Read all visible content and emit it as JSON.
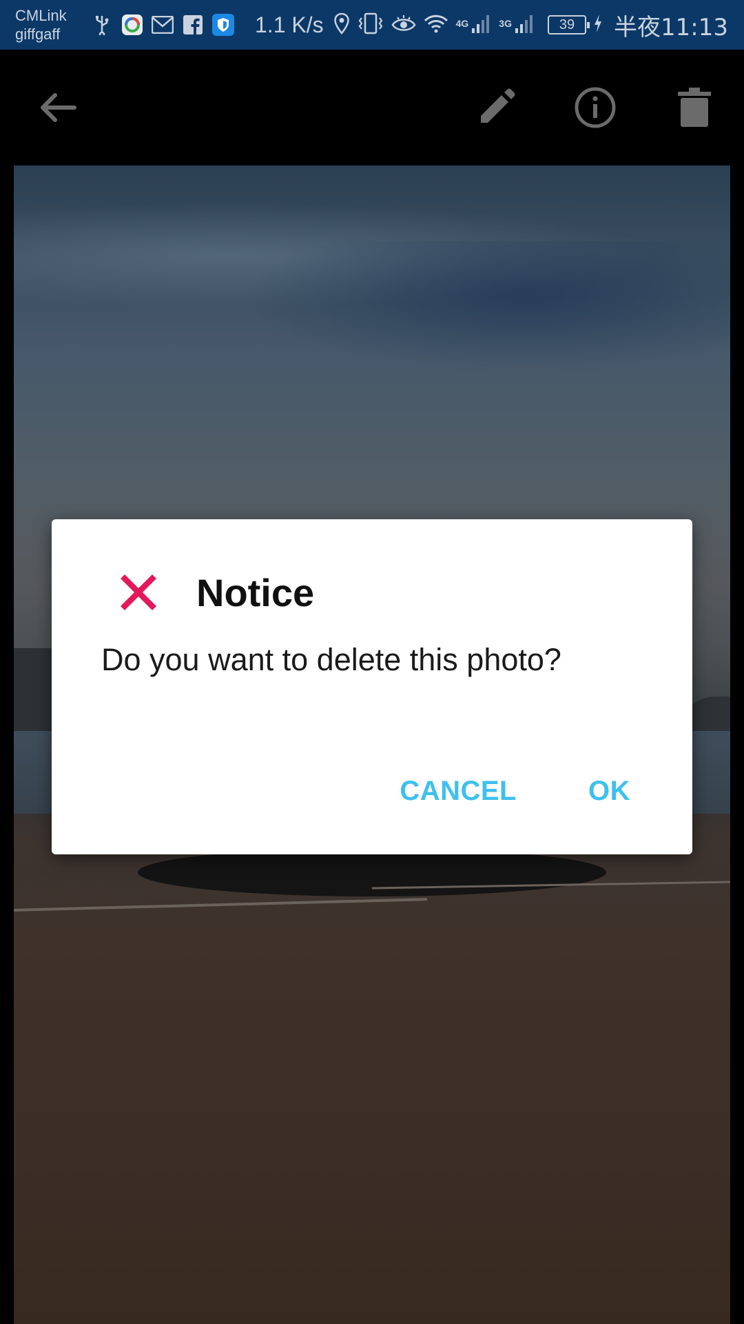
{
  "status_bar": {
    "carrier_line1": "CMLink",
    "carrier_line2": "giffgaff",
    "notification_icons": [
      "usb-icon",
      "camera-app-icon",
      "mail-icon",
      "facebook-icon",
      "shield-icon"
    ],
    "net_speed": "1.1 K/s",
    "network_4g": "4G",
    "network_3g": "3G",
    "battery_level": "39",
    "time": "半夜11:13",
    "background_color": "#0c3867"
  },
  "toolbar": {
    "back_icon": "arrow-back-icon",
    "edit_icon": "pencil-icon",
    "info_icon": "info-icon",
    "delete_icon": "trash-icon"
  },
  "dialog": {
    "icon": "red-x-icon",
    "icon_color": "#e4195a",
    "title": "Notice",
    "message": "Do you want to delete this photo?",
    "cancel_label": "CANCEL",
    "ok_label": "OK",
    "button_color": "#3ec0ee"
  }
}
